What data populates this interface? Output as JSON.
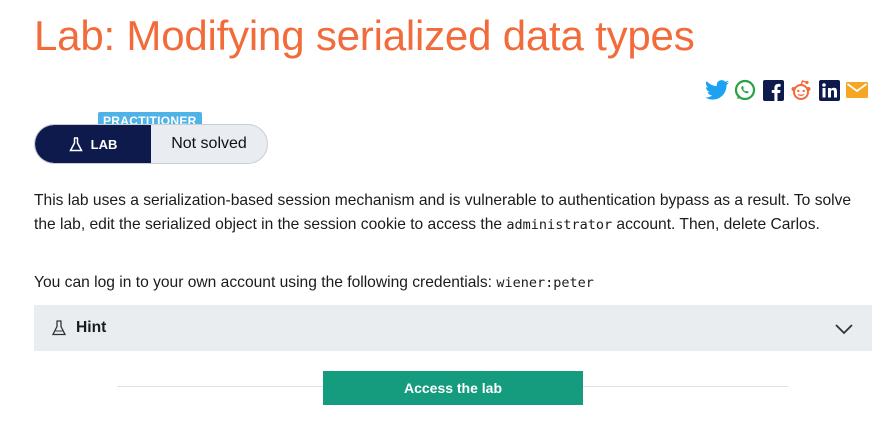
{
  "page": {
    "title": "Lab: Modifying serialized data types"
  },
  "share": [
    "twitter-icon",
    "whatsapp-icon",
    "facebook-icon",
    "reddit-icon",
    "linkedin-icon",
    "email-icon"
  ],
  "badge": {
    "level": "PRACTITIONER",
    "type_label": "LAB",
    "status": "Not solved"
  },
  "description": {
    "part1": "This lab uses a serialization-based session mechanism and is vulnerable to authentication bypass as a result. To solve the lab, edit the serialized object in the session cookie to access the ",
    "code": "administrator",
    "part2": " account. Then, delete Carlos."
  },
  "credentials": {
    "text": "You can log in to your own account using the following credentials: ",
    "code": "wiener:peter"
  },
  "hint": {
    "label": "Hint"
  },
  "actions": {
    "access_label": "Access the lab"
  },
  "colors": {
    "title": "#f26b3a",
    "badge_dark": "#0d1a4b",
    "level": "#4fb3e8",
    "access": "#159b7e"
  }
}
